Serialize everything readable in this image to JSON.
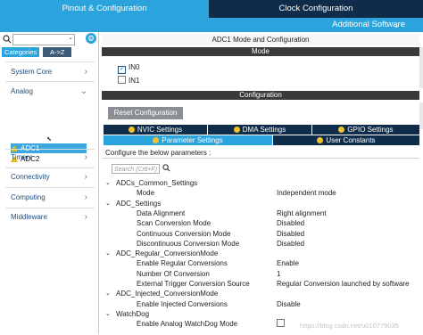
{
  "top_tabs": {
    "pinout": "Pinout & Configuration",
    "clock": "Clock Configuration"
  },
  "additional_software": "Additional Software",
  "left": {
    "search_placeholder": "",
    "tabs": {
      "categories": "Categories",
      "az": "A->Z"
    },
    "categories": [
      {
        "label": "System Core",
        "arrow": "›"
      },
      {
        "label": "Analog",
        "arrow": "⌄"
      },
      {
        "label": "Timers",
        "arrow": "›"
      },
      {
        "label": "Connectivity",
        "arrow": "›"
      },
      {
        "label": "Computing",
        "arrow": "›"
      },
      {
        "label": "Middleware",
        "arrow": "›"
      }
    ],
    "analog_items": [
      "ADC1",
      "ADC2"
    ]
  },
  "main": {
    "title": "ADC1 Mode and Configuration",
    "mode_header": "Mode",
    "mode_items": [
      {
        "label": "IN0",
        "checked": true
      },
      {
        "label": "IN1",
        "checked": false
      }
    ],
    "config_header": "Configuration",
    "reset_button": "Reset Configuration",
    "tabs": {
      "nvic": "NVIC Settings",
      "dma": "DMA Settings",
      "gpio": "GPIO Settings",
      "params": "Parameter Settings",
      "user": "User Constants"
    },
    "params_label": "Configure the below parameters :",
    "search_placeholder": "Search (Crtl+F)",
    "tree": [
      {
        "type": "group",
        "name": "ADCs_Common_Settings"
      },
      {
        "type": "param",
        "name": "Mode",
        "value": "Independent mode"
      },
      {
        "type": "group",
        "name": "ADC_Settings"
      },
      {
        "type": "param",
        "name": "Data Alignment",
        "value": "Right alignment"
      },
      {
        "type": "param",
        "name": "Scan Conversion Mode",
        "value": "Disabled"
      },
      {
        "type": "param",
        "name": "Continuous Conversion Mode",
        "value": "Disabled"
      },
      {
        "type": "param",
        "name": "Discontinuous Conversion Mode",
        "value": "Disabled"
      },
      {
        "type": "group",
        "name": "ADC_Regular_ConversionMode"
      },
      {
        "type": "param",
        "name": "Enable Regular Conversions",
        "value": "Enable"
      },
      {
        "type": "param",
        "name": "Number Of Conversion",
        "value": "1"
      },
      {
        "type": "param",
        "name": "External Trigger Conversion Source",
        "value": "Regular Conversion launched by software"
      },
      {
        "type": "group",
        "name": "ADC_Injected_ConversionMode"
      },
      {
        "type": "param",
        "name": "Enable Injected Conversions",
        "value": "Disable"
      },
      {
        "type": "group",
        "name": "WatchDog"
      },
      {
        "type": "param",
        "name": "Enable Analog WatchDog Mode",
        "value": "",
        "checkbox": true
      }
    ]
  },
  "watermark": "https://blog.csdn.net/u010779035",
  "colors": {
    "accent": "#2ba3dc",
    "dark": "#0f2d4a",
    "warning": "#e3b915"
  }
}
